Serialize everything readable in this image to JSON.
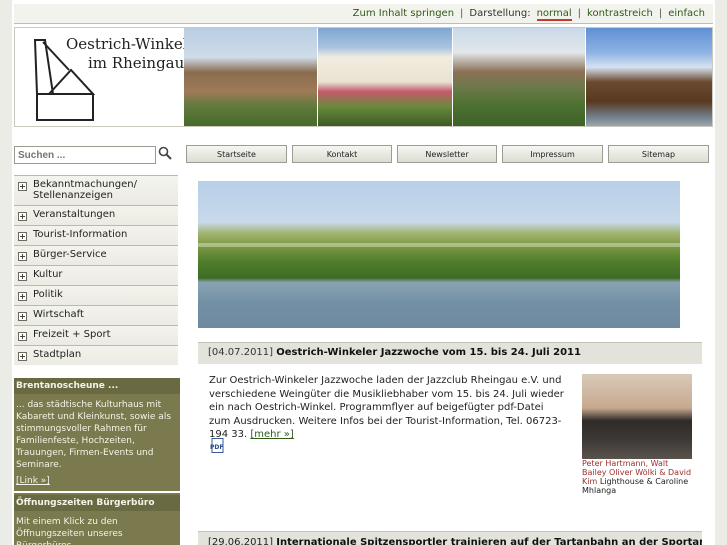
{
  "topbar": {
    "skip_link": "Zum Inhalt springen",
    "display_label": "Darstellung:",
    "modes": [
      "normal",
      "kontrastreich",
      "einfach"
    ],
    "active_mode": "normal"
  },
  "logo": {
    "line1": "Oestrich-Winkel",
    "line2": "im Rheingau"
  },
  "search": {
    "placeholder": "Suchen ..."
  },
  "nav": [
    "Startseite",
    "Kontakt",
    "Newsletter",
    "Impressum",
    "Sitemap"
  ],
  "sidebar": {
    "items": [
      "Bekanntmachungen/ Stellenanzeigen",
      "Veranstaltungen",
      "Tourist-Information",
      "Bürger-Service",
      "Kultur",
      "Politik",
      "Wirtschaft",
      "Freizeit + Sport",
      "Stadtplan"
    ]
  },
  "infobox": {
    "heading1": "Brentanoscheune ...",
    "text1": "... das städtische Kulturhaus mit Kabarett und Kleinkunst, sowie als stimmungsvoller Rahmen für Familienfeste, Hochzeiten, Trauungen, Firmen-Events und Seminare.",
    "link1": "[Link »]",
    "heading2": "Öffnungszeiten Bürgerbüro",
    "text2": "Mit einem Klick zu den Öffnungszeiten unseres Bürgerbüros."
  },
  "news": [
    {
      "date": "[04.07.2011]",
      "title": "Oestrich-Winkeler Jazzwoche vom 15. bis 24. Juli 2011",
      "text": "Zur Oestrich-Winkeler Jazzwoche laden der Jazzclub Rheingau e.V. und verschiedene Weingüter die Musikliebhaber vom 15. bis 24. Juli wieder ein nach Oestrich-Winkel. Programmflyer auf beigefügter pdf-Datei zum Ausdrucken. Weitere Infos bei der Tourist-Information, Tel. 06723-194 33.",
      "more": "[mehr »]",
      "caption_red": "Peter Hartmann, Walt Bailey Oliver Wölki & David Kim",
      "caption": "Lighthouse & Caroline Mhlanga"
    },
    {
      "date": "[29.06.2011]",
      "title": "Internationale Spitzensportler trainieren auf der Tartanbahn an der Sportanlage in Winkel"
    }
  ],
  "colors": {
    "link_green": "#2f5a1a",
    "active_red": "#c23a2a",
    "infobox_olive": "#7a7a4e"
  },
  "icons": [
    "search-icon",
    "plus-icon",
    "pdf-icon"
  ]
}
